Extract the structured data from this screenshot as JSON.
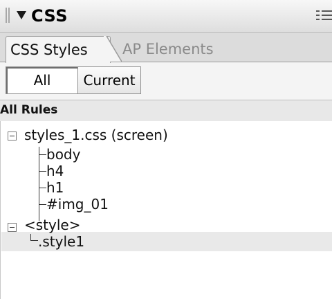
{
  "panel": {
    "title": "CSS",
    "icons": {
      "gripper": "gripper-icon",
      "collapse": "triangle-down-icon",
      "menu": "panel-menu-icon"
    }
  },
  "tabs": [
    {
      "label": "CSS Styles",
      "active": true
    },
    {
      "label": "AP Elements",
      "active": false
    }
  ],
  "mode_buttons": {
    "all": "All",
    "current": "Current",
    "selected": "All"
  },
  "rules_header": "All Rules",
  "tree": {
    "stylesheet": {
      "label": "styles_1.css (screen)",
      "children": [
        "body",
        "h4",
        "h1",
        "#img_01"
      ]
    },
    "style_block": {
      "label": "<style>",
      "children": [
        ".style1"
      ]
    }
  },
  "colors": {
    "selected_row": "#e9e9e9",
    "inactive_tab_text": "#8a8a8a"
  }
}
